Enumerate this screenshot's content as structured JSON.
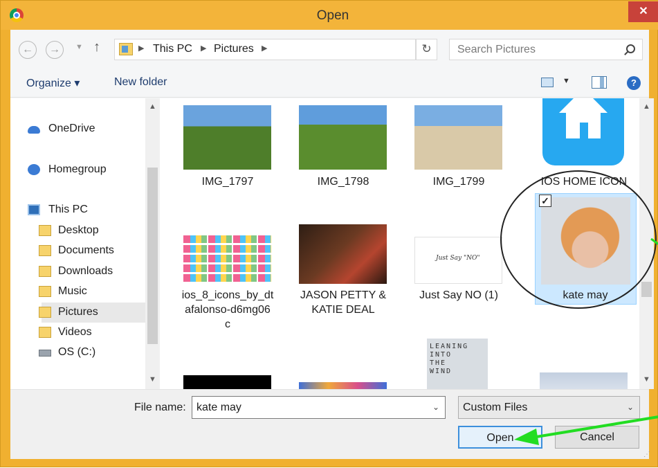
{
  "window": {
    "title": "Open",
    "close_label": "✕"
  },
  "address": {
    "crumbs": [
      "This PC",
      "Pictures"
    ],
    "search_placeholder": "Search Pictures"
  },
  "toolbar": {
    "organize": "Organize ▾",
    "new_folder": "New folder"
  },
  "nav": {
    "onedrive": "OneDrive",
    "homegroup": "Homegroup",
    "thispc": "This PC",
    "desktop": "Desktop",
    "documents": "Documents",
    "downloads": "Downloads",
    "music": "Music",
    "pictures": "Pictures",
    "videos": "Videos",
    "osdrive": "OS (C:)"
  },
  "files": {
    "img1797": "IMG_1797",
    "img1798": "IMG_1798",
    "img1799": "IMG_1799",
    "ioshome": "IOS HOME ICON",
    "ios8_line1": "ios_8_icons_by_dt",
    "ios8_line2": "afalonso-d6mg06",
    "ios8_line3": "c",
    "jason_line1": "JASON PETTY &",
    "jason_line2": "KATIE DEAL",
    "justsay": "Just Say NO (1)",
    "katemay": "kate may",
    "justsay_thumb_text": "Just Say \"NO\"",
    "book_thumb_text": "LEANING\nINTO\nTHE\nWIND"
  },
  "bottom": {
    "filename_label": "File name:",
    "filename_value": "kate may",
    "filetype_value": "Custom Files",
    "open_label": "Open",
    "cancel_label": "Cancel"
  },
  "colors": {
    "window_frame": "#f0b030",
    "close": "#c8423a",
    "annotation_arrow": "#22dd22",
    "selection": "#cce8ff"
  }
}
